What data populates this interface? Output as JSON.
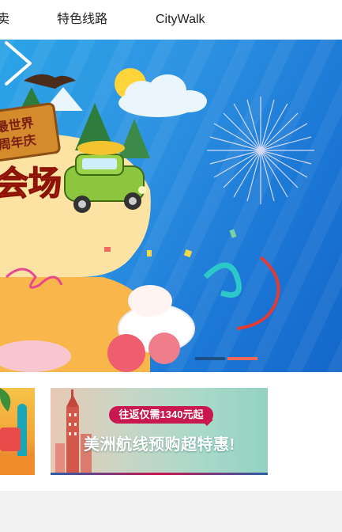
{
  "nav": {
    "tabs": [
      {
        "label": "卖"
      },
      {
        "label": "特色线路"
      },
      {
        "label": "CityWalk"
      }
    ]
  },
  "banner": {
    "sign_line1": "最世界",
    "sign_line2": "周年庆",
    "big_text": "会场",
    "next_icon": "chevron-right-icon",
    "carousel": {
      "total": 2,
      "active": 2,
      "active_color": "#f26a5b",
      "inactive_color": "#1d4f86"
    }
  },
  "promos": [
    {
      "name": "beach-promo"
    },
    {
      "tagline": "往返仅需1340元起",
      "headline": "美洲航线预购超特惠!"
    }
  ],
  "colors": {
    "banner_blue": "#2f95e3",
    "accent_red": "#c9174f"
  }
}
